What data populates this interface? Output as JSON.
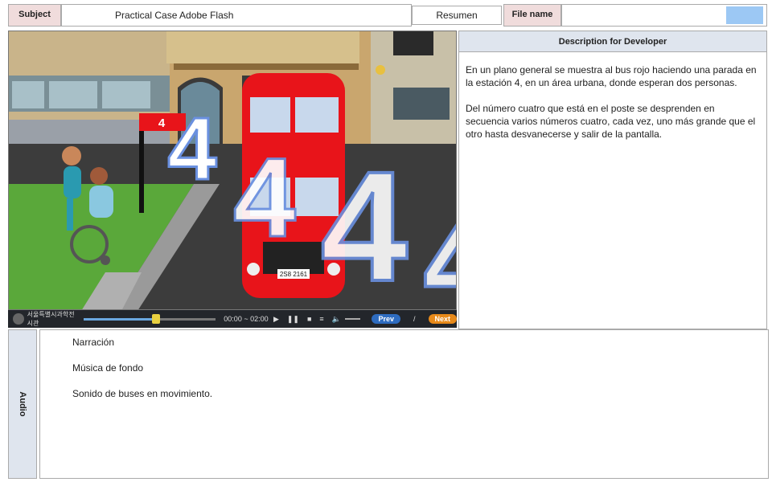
{
  "header": {
    "subject_label": "Subject",
    "subject_value": "Practical Case Adobe Flash",
    "resumen_label": "Resumen",
    "file_name_label": "File name"
  },
  "scene": {
    "bus_stop_number": "4",
    "flying_numbers": [
      "4",
      "4",
      "4",
      "4"
    ],
    "license_plate": "2S8 2161"
  },
  "player": {
    "logo_text": "서울특별시과학전시관",
    "time": "00:00 ~ 02:00",
    "prev_label": "Prev",
    "separator": "/",
    "next_label": "Next",
    "progress": 0.55
  },
  "description": {
    "title": "Description for Developer",
    "paragraphs": [
      "En un plano general se muestra al bus rojo haciendo una parada en la estación 4, en un área urbana, donde esperan dos personas.",
      "Del número cuatro que está en el poste se desprenden en secuencia varios números cuatro, cada vez, uno más grande que el otro hasta desvanecerse y salir de la pantalla."
    ]
  },
  "audio": {
    "side_label": "Audio",
    "items": [
      "Narración",
      "Música de fondo",
      "Sonido de buses en movimiento."
    ]
  },
  "colors": {
    "bus_red": "#e8141a",
    "header_label_bg": "#f0dcdc",
    "panel_bg": "#dfe5ee",
    "accent_blue": "#9cc8f4",
    "next_orange": "#e88a1a",
    "prev_blue": "#2e6cc0"
  }
}
